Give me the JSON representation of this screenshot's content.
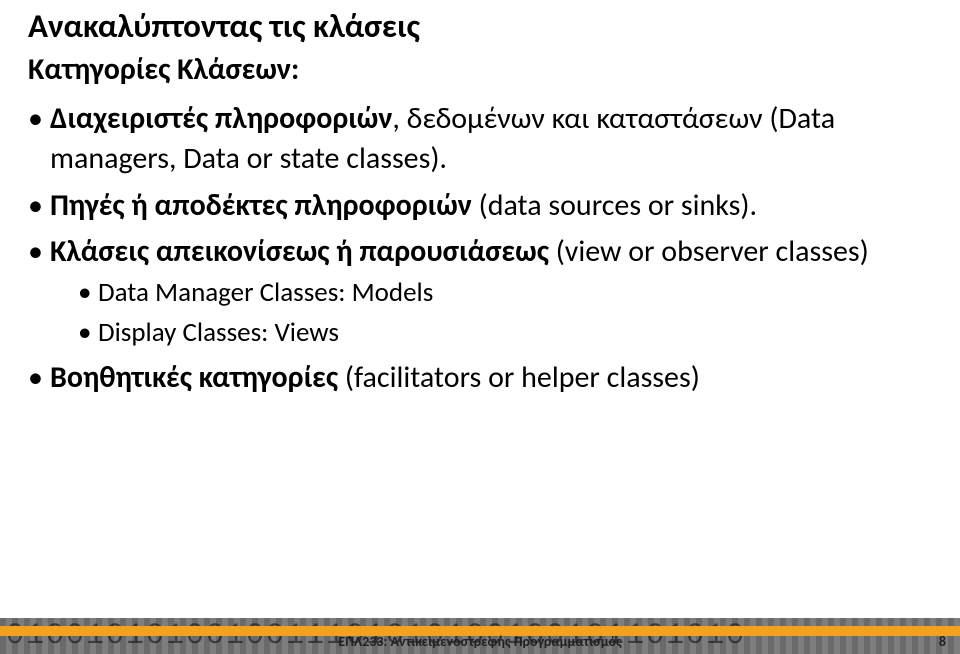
{
  "title": "Ανακαλύπτοντας τις κλάσεις",
  "subtitle": "Κατηγορίες Κλάσεων:",
  "bullets": [
    {
      "pre": "",
      "bold": "Διαχειριστές πληροφοριών",
      "post": ", δεδομένων και καταστάσεων (Data managers, Data or state classes).",
      "children": []
    },
    {
      "pre": "",
      "bold": "Πηγές ή αποδέκτες πληροφοριών",
      "post": " (data sources or sinks).",
      "children": []
    },
    {
      "pre": "",
      "bold": "Κλάσεις απεικονίσεως ή παρουσιάσεως",
      "post": " (view or observer classes)",
      "children": [
        {
          "text": "Data Manager Classes: Models"
        },
        {
          "text": "Display Classes: Views"
        }
      ]
    },
    {
      "pre": "",
      "bold": "Βοηθητικές κατηγορίες",
      "post": " (facilitators or helper classes)",
      "children": []
    }
  ],
  "footer": {
    "course": "ΕΠΛ233: Αντικειμενοστρεφής Προγραμματισμός",
    "page": "8",
    "binary": "0100101010010011101010100100101101010"
  }
}
